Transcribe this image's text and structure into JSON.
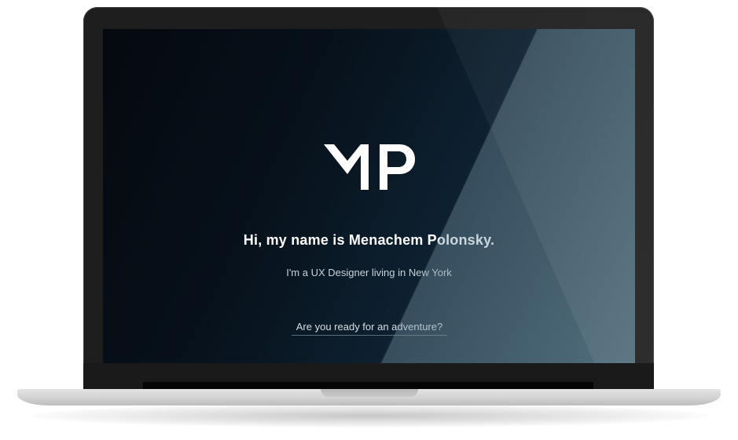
{
  "hero": {
    "logo_text": "MP",
    "headline": "Hi, my name is Menachem Polonsky.",
    "subline": "I'm a UX Designer living in New York",
    "cta_label": "Are you ready for an adventure?"
  },
  "colors": {
    "background_dark": "#05090f",
    "background_light": "#17303f",
    "text": "#ffffff",
    "laptop_frame": "#1e1e1e",
    "laptop_base": "#d2d2d2"
  }
}
